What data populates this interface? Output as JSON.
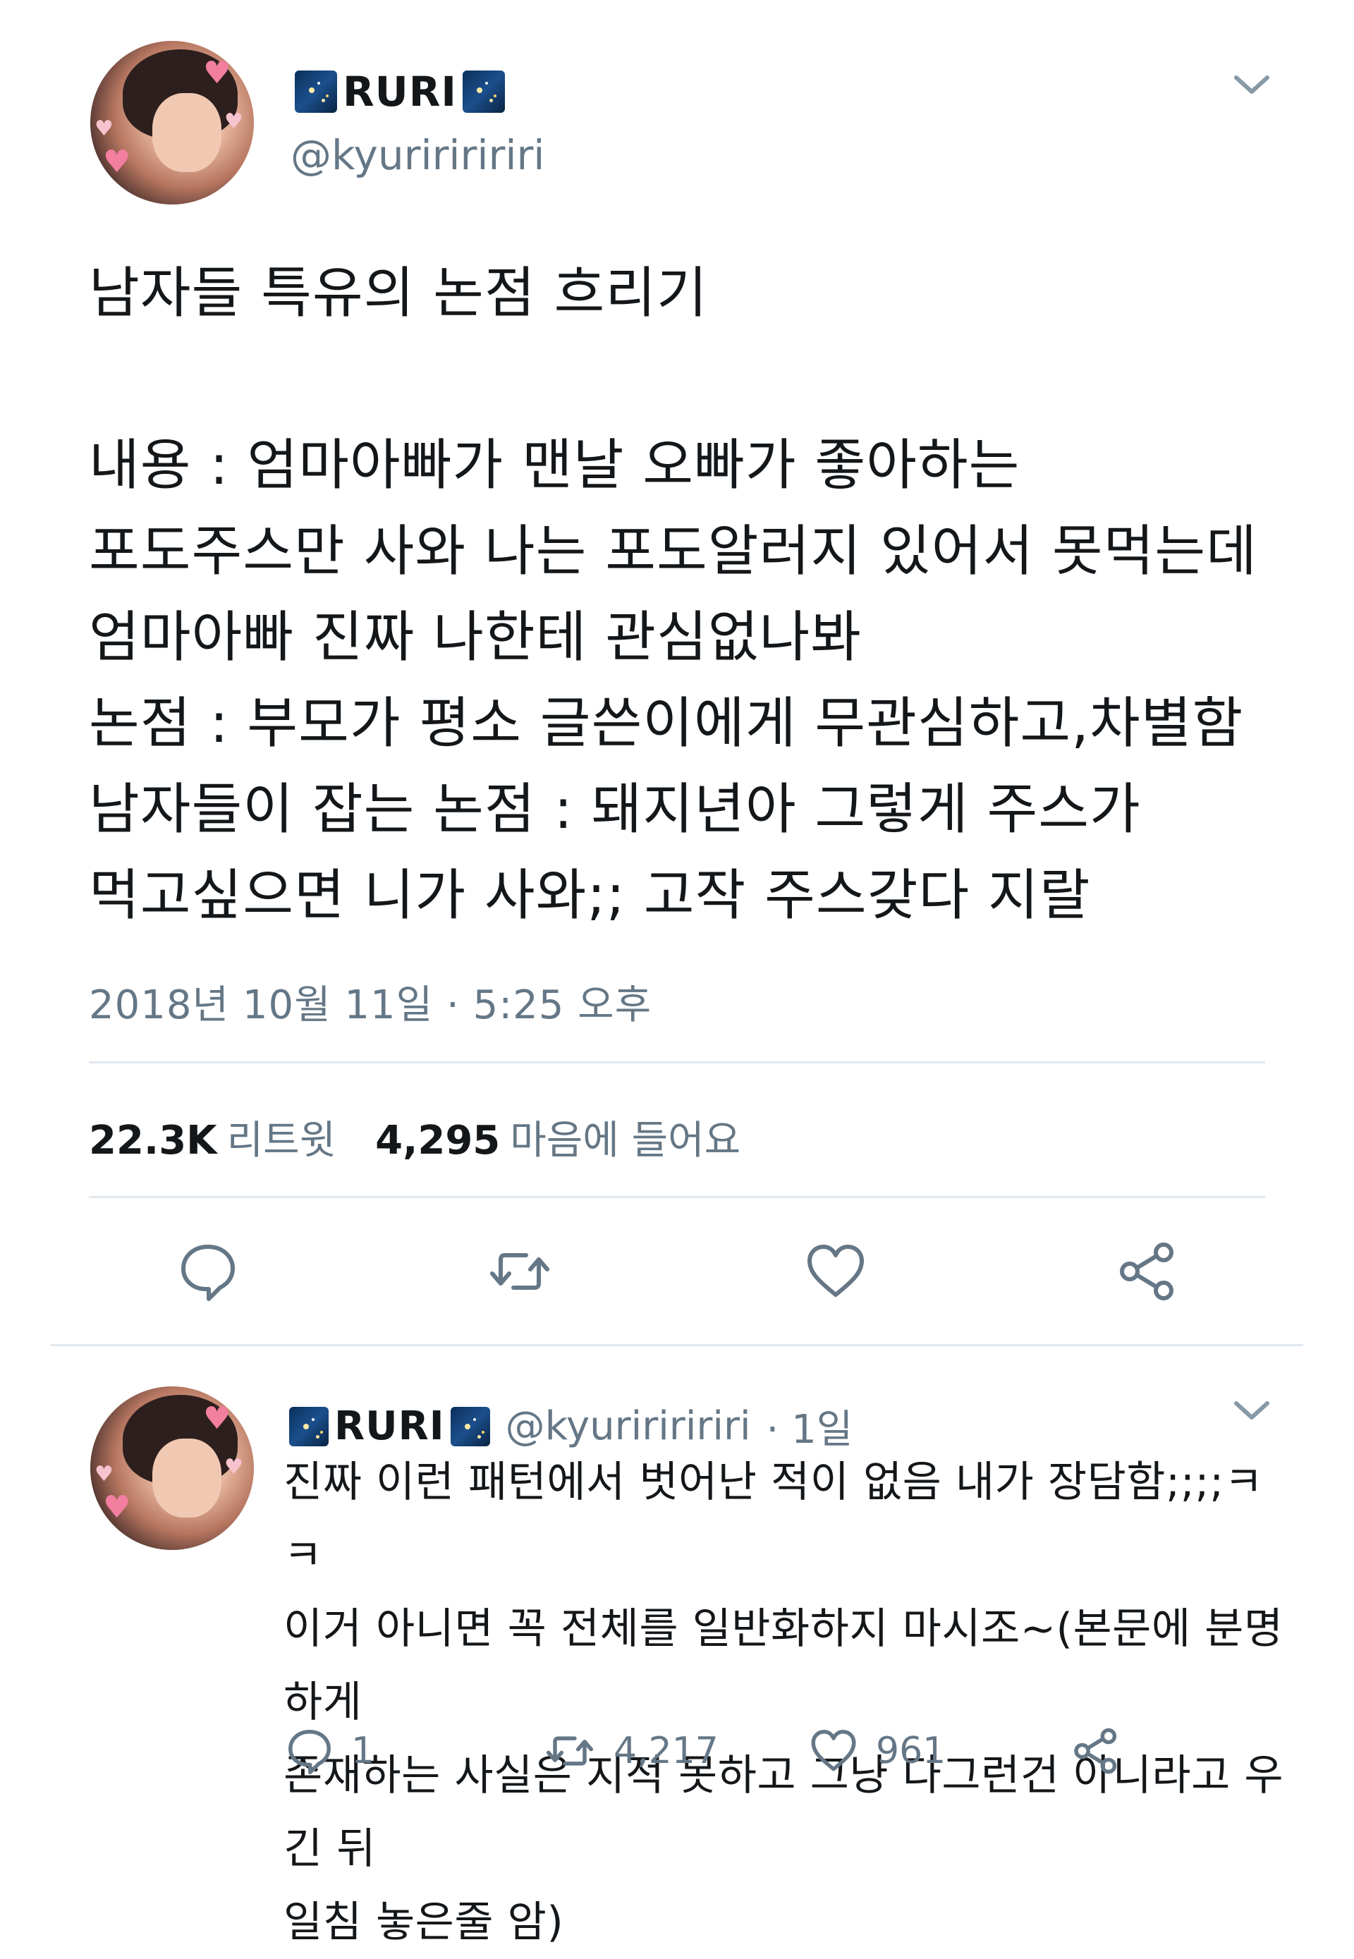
{
  "tweet": {
    "display_name": "RURI",
    "handle": "@kyuririririri",
    "text": "남자들 특유의 논점 흐리기\n\n내용 : 엄마아빠가 맨날 오빠가 좋아하는\n포도주스만 사와 나는 포도알러지 있어서 못먹는데\n엄마아빠 진짜 나한테 관심없나봐\n논점 : 부모가 평소 글쓴이에게 무관심하고,차별함\n남자들이 잡는 논점 : 돼지년아 그렇게 주스가\n먹고싶으면 니가 사와;; 고작 주스갖다 지랄",
    "timestamp": "2018년 10월 11일 · 5:25 오후",
    "retweets_count": "22.3K",
    "retweets_label": "리트윗",
    "likes_count": "4,295",
    "likes_label": "마음에 들어요"
  },
  "reply": {
    "display_name": "RURI",
    "handle": "@kyuririririri",
    "time": "· 1일",
    "text": "진짜 이런 패턴에서 벗어난 적이 없음 내가 장담함;;;;ㅋㅋ\n이거 아니면 꼭 전체를 일반화하지 마시조~(본문에 분명하게\n존재하는 사실은 지적 못하고 그냥 다그런건 아니라고 우긴 뒤\n일침 놓은줄 암)",
    "reply_count": "1",
    "retweet_count": "4,217",
    "like_count": "961"
  },
  "icons": {
    "avatar": "avatar-image",
    "name_emoji": "night-sky-emoji",
    "menu": "chevron-down-icon",
    "reply": "reply-icon",
    "retweet": "retweet-icon",
    "like": "heart-icon",
    "share": "share-icon"
  },
  "colors": {
    "text": "#14171a",
    "secondary": "#657786",
    "divider": "#e1e8ed",
    "icon": "#657786"
  }
}
